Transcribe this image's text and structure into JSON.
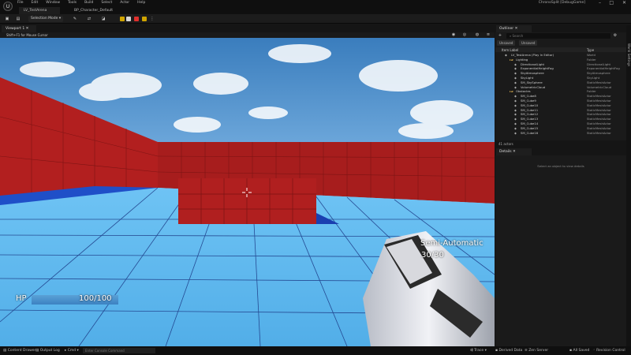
{
  "app": {
    "menus": [
      "File",
      "Edit",
      "Window",
      "Tools",
      "Build",
      "Select",
      "Actor",
      "Help"
    ],
    "window_title": "ChronoSplit [DebugGame]"
  },
  "tabs": [
    {
      "label": "LV_TestArena",
      "active": true
    },
    {
      "label": "BP_Character_Default",
      "active": false
    }
  ],
  "toolbar": {
    "selection_mode": "Selection Mode",
    "colors": {
      "play": "#d7d7d7",
      "pause": "#d0a400",
      "stop": "#e0302d",
      "eject": "#d0a400"
    }
  },
  "viewport": {
    "tab_label": "Viewport 1",
    "hint": "Shift+F1 for Mouse Cursor"
  },
  "hud": {
    "hp_label": "HP",
    "hp_value": "100/100",
    "hp_fraction": 1.0,
    "fire_mode": "Semi-Automatic",
    "ammo": "30/30"
  },
  "outliner": {
    "tab_label": "Outliner",
    "search_placeholder": "Search",
    "filters": [
      "Unsaved",
      "Unsaved"
    ],
    "col_label": "Item Label",
    "col_type": "Type",
    "rows": [
      {
        "label": "LV_TestArena (Play In Editor)",
        "type": "World",
        "indent": 1
      },
      {
        "label": "Lighting",
        "type": "Folder",
        "indent": 2
      },
      {
        "label": "DirectionalLight",
        "type": "DirectionalLight",
        "indent": 3
      },
      {
        "label": "ExponentialHeightFog",
        "type": "ExponentialHeightFog",
        "indent": 3
      },
      {
        "label": "SkyAtmosphere",
        "type": "SkyAtmosphere",
        "indent": 3
      },
      {
        "label": "SkyLight",
        "type": "SkyLight",
        "indent": 3
      },
      {
        "label": "SM_SkySphere",
        "type": "StaticMeshActor",
        "indent": 3
      },
      {
        "label": "VolumetricCloud",
        "type": "VolumetricCloud",
        "indent": 3
      },
      {
        "label": "Obstacles",
        "type": "Folder",
        "indent": 2
      },
      {
        "label": "SM_Cube8",
        "type": "StaticMeshActor",
        "indent": 3
      },
      {
        "label": "SM_Cube9",
        "type": "StaticMeshActor",
        "indent": 3
      },
      {
        "label": "SM_Cube10",
        "type": "StaticMeshActor",
        "indent": 3
      },
      {
        "label": "SM_Cube11",
        "type": "StaticMeshActor",
        "indent": 3
      },
      {
        "label": "SM_Cube12",
        "type": "StaticMeshActor",
        "indent": 3
      },
      {
        "label": "SM_Cube13",
        "type": "StaticMeshActor",
        "indent": 3
      },
      {
        "label": "SM_Cube14",
        "type": "StaticMeshActor",
        "indent": 3
      },
      {
        "label": "SM_Cube15",
        "type": "StaticMeshActor",
        "indent": 3
      },
      {
        "label": "SM_Cube16",
        "type": "StaticMeshActor",
        "indent": 3
      }
    ],
    "actor_count": "41 actors"
  },
  "details": {
    "tab_label": "Details",
    "empty_message": "Select an object to view details"
  },
  "side_panel": {
    "label": "World Settings"
  },
  "statusbar": {
    "content_drawer": "Content Drawer",
    "output_log": "Output Log",
    "cmd": "Cmd",
    "cmd_placeholder": "Enter Console Command",
    "trace": "Trace",
    "derived_data": "Derived Data",
    "zen_server": "Zen Server",
    "all_saved": "All Saved",
    "revision_control": "Revision Control"
  }
}
